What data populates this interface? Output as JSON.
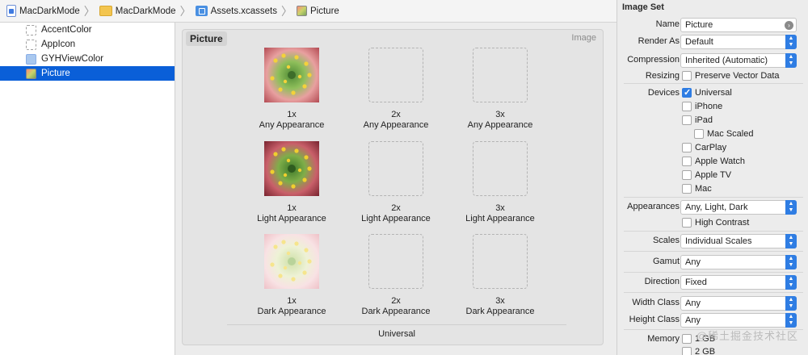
{
  "breadcrumb": {
    "items": [
      {
        "label": "MacDarkMode",
        "icon": "project-file-icon"
      },
      {
        "label": "MacDarkMode",
        "icon": "folder-icon"
      },
      {
        "label": "Assets.xcassets",
        "icon": "asset-catalog-icon"
      },
      {
        "label": "Picture",
        "icon": "image-set-icon"
      }
    ],
    "separator": "〉"
  },
  "sidebar": {
    "items": [
      {
        "label": "AccentColor",
        "icon": "color-set-icon",
        "selected": false
      },
      {
        "label": "AppIcon",
        "icon": "app-icon-set-icon",
        "selected": false
      },
      {
        "label": "GYHViewColor",
        "icon": "color-set-icon",
        "selected": false
      },
      {
        "label": "Picture",
        "icon": "image-set-icon",
        "selected": true
      }
    ]
  },
  "editor": {
    "title": "Picture",
    "kind": "Image",
    "rows": [
      {
        "appearance": "Any Appearance",
        "slots": [
          {
            "scale": "1x",
            "filled": true,
            "variant": "normal"
          },
          {
            "scale": "2x",
            "filled": false
          },
          {
            "scale": "3x",
            "filled": false
          }
        ]
      },
      {
        "appearance": "Light Appearance",
        "slots": [
          {
            "scale": "1x",
            "filled": true,
            "variant": "light"
          },
          {
            "scale": "2x",
            "filled": false
          },
          {
            "scale": "3x",
            "filled": false
          }
        ]
      },
      {
        "appearance": "Dark Appearance",
        "slots": [
          {
            "scale": "1x",
            "filled": true,
            "variant": "washed"
          },
          {
            "scale": "2x",
            "filled": false
          },
          {
            "scale": "3x",
            "filled": false
          }
        ]
      }
    ],
    "footer": "Universal"
  },
  "inspector": {
    "section_title": "Image Set",
    "name": {
      "label": "Name",
      "value": "Picture"
    },
    "render_as": {
      "label": "Render As",
      "value": "Default"
    },
    "compression": {
      "label": "Compression",
      "value": "Inherited (Automatic)"
    },
    "resizing": {
      "label": "Resizing",
      "option": "Preserve Vector Data",
      "checked": false
    },
    "devices": {
      "label": "Devices",
      "options": [
        {
          "label": "Universal",
          "checked": true
        },
        {
          "label": "iPhone",
          "checked": false
        },
        {
          "label": "iPad",
          "checked": false
        },
        {
          "label": "Mac Scaled",
          "checked": false
        },
        {
          "label": "CarPlay",
          "checked": false
        },
        {
          "label": "Apple Watch",
          "checked": false
        },
        {
          "label": "Apple TV",
          "checked": false
        },
        {
          "label": "Mac",
          "checked": false
        }
      ]
    },
    "appearances": {
      "label": "Appearances",
      "value": "Any, Light, Dark"
    },
    "high_contrast": {
      "label": "High Contrast",
      "checked": false
    },
    "scales": {
      "label": "Scales",
      "value": "Individual Scales"
    },
    "gamut": {
      "label": "Gamut",
      "value": "Any"
    },
    "direction": {
      "label": "Direction",
      "value": "Fixed"
    },
    "width_class": {
      "label": "Width Class",
      "value": "Any"
    },
    "height_class": {
      "label": "Height Class",
      "value": "Any"
    },
    "memory": {
      "label": "Memory",
      "options": [
        {
          "label": "1 GB",
          "checked": false
        },
        {
          "label": "2 GB",
          "checked": false
        }
      ]
    }
  },
  "watermark": "@稀土掘金技术社区",
  "colors": {
    "selection": "#0a5fd8",
    "accent": "#2f7de3"
  }
}
